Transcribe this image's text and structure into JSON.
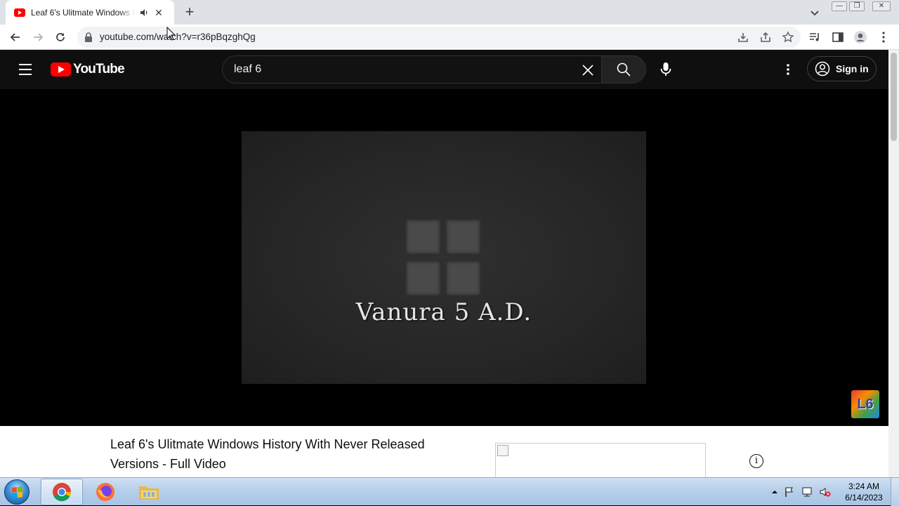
{
  "browser": {
    "tab": {
      "title": "Leaf 6's Ulitmate Windows History With Never Released Versions - Full Video",
      "close": "✕"
    },
    "new_tab": "+",
    "window_controls": {
      "minimize": "—",
      "restore": "❐",
      "close": "✕"
    },
    "url": "youtube.com/watch?v=r36pBqzghQg",
    "url_display": "youtube.com/watch?v=r36pBqzghQg"
  },
  "youtube": {
    "logo_text": "YouTube",
    "search_query": "leaf 6",
    "sign_in": "Sign in",
    "brand_red": "#ff0000"
  },
  "video": {
    "overlay_text": "Vanura 5 A.D.",
    "channel_watermark": "L6",
    "title": "Leaf 6's Ulitmate Windows History With Never Released Versions - Full Video",
    "info_icon": "i"
  },
  "taskbar": {
    "time": "3:24 AM",
    "date": "6/14/2023",
    "apps": [
      "chrome-icon",
      "firefox-icon",
      "file-explorer-icon"
    ]
  }
}
